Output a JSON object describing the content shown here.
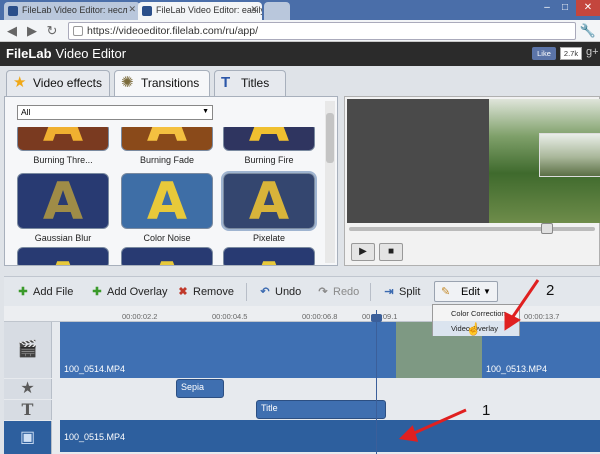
{
  "browser": {
    "tabs": [
      {
        "label": "FileLab Video Editor: несл"
      },
      {
        "label": "FileLab Video Editor: easily"
      }
    ],
    "url": "https://videoeditor.filelab.com/ru/app/"
  },
  "app": {
    "logo": "FileLab",
    "title": "Video Editor",
    "like_label": "Like",
    "like_count": "2.7k",
    "gplus": "g+"
  },
  "fx_tabs": [
    {
      "label": "Video effects",
      "icon": "star-icon"
    },
    {
      "label": "Transitions",
      "icon": "film-reel-icon"
    },
    {
      "label": "Titles",
      "icon": "title-icon"
    }
  ],
  "filter": {
    "selected": "All"
  },
  "transitions": [
    {
      "label": "Burning Thre..."
    },
    {
      "label": "Burning Fade"
    },
    {
      "label": "Burning Fire"
    },
    {
      "label": "Gaussian Blur"
    },
    {
      "label": "Color Noise"
    },
    {
      "label": "Pixelate"
    }
  ],
  "toolbar": {
    "add_file": "Add File",
    "add_overlay": "Add Overlay",
    "remove": "Remove",
    "undo": "Undo",
    "redo": "Redo",
    "split": "Split",
    "edit": "Edit"
  },
  "edit_menu": {
    "color_correction": "Color Correction",
    "video_overlay": "Video Overlay"
  },
  "ruler": [
    "00:00:02.2",
    "00:00:04.5",
    "00:00:06.8",
    "00:00:09.1",
    "00:00:13.7"
  ],
  "tracks": {
    "video_left": "100_0514.MP4",
    "video_right": "100_0513.MP4",
    "effect": "Sepia",
    "title": "Title",
    "overlay": "100_0515.MP4"
  },
  "annotations": {
    "one": "1",
    "two": "2"
  }
}
